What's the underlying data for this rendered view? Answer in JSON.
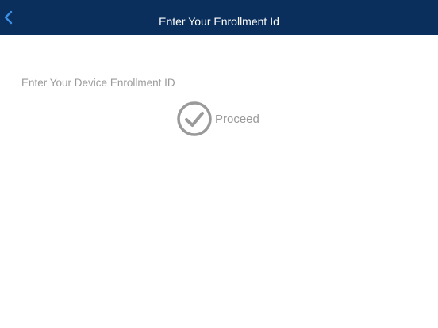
{
  "header": {
    "title": "Enter Your Enrollment Id",
    "back_icon": "chevron-left-icon",
    "background_color": "#0b2f5c",
    "back_icon_color": "#3d8ee8"
  },
  "form": {
    "enrollment_input": {
      "value": "",
      "placeholder": "Enter Your Device Enrollment ID"
    },
    "proceed_button": {
      "label": "Proceed",
      "icon": "check-circle-icon",
      "color": "#9a9a9a"
    }
  }
}
